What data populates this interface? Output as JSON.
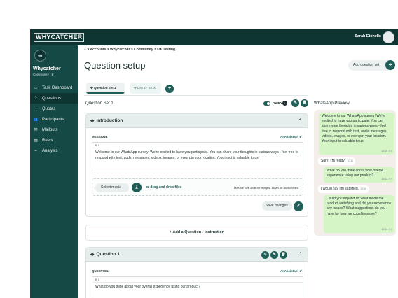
{
  "topbar": {
    "logo": "WHYCATCHER",
    "user_name": "Sarah Etchells"
  },
  "sidebar": {
    "avatar_initials": "WY",
    "org_name": "Whycatcher",
    "org_type": "Community",
    "org_type_icon": "♛",
    "items": [
      {
        "label": "Task Dashboard",
        "icon": "home-icon",
        "glyph": "⌂",
        "active": false
      },
      {
        "label": "Questions",
        "icon": "question-icon",
        "glyph": "?",
        "active": true
      },
      {
        "label": "Quotas",
        "icon": "quota-icon",
        "glyph": "◔",
        "active": false
      },
      {
        "label": "Participants",
        "icon": "participants-icon",
        "glyph": "👥",
        "active": false
      },
      {
        "label": "Mailouts",
        "icon": "mail-icon",
        "glyph": "✉",
        "active": false
      },
      {
        "label": "Reels",
        "icon": "film-icon",
        "glyph": "▤",
        "active": false
      },
      {
        "label": "Analysis",
        "icon": "chart-icon",
        "glyph": "⌁",
        "active": false
      }
    ]
  },
  "breadcrumb": {
    "home_glyph": "⌂",
    "sep": ">",
    "items": [
      "Accounts",
      "Whycatcher",
      "Community",
      "UX Testing"
    ]
  },
  "page": {
    "title": "Question setup",
    "add_set_label": "Add question set",
    "plus": "+"
  },
  "tabs": [
    {
      "label": "Question Set 1",
      "icon": "✥"
    },
    {
      "label": "Day 2 - 09:00",
      "icon": "✥"
    }
  ],
  "question_set": {
    "label": "Question Set 1",
    "diary_label": "DAIRY",
    "info_glyph": "i",
    "edit_glyph": "✎",
    "delete_glyph": "🗑"
  },
  "intro": {
    "title": "Introduction",
    "drag_glyph": "✥",
    "chevron": "⌃",
    "message_label": "MESSAGE",
    "ai_label": "AI Assistant ✐",
    "toolbar": "B  I",
    "message_text": "Welcome to our WhatsApp survey! We're excited to have you participate. You can share your thoughts in various ways - feel free to respond with text, audio messages, videos, images, or even pin your location. Your input is valuable to us!",
    "select_media_label": "Select media",
    "upload_glyph": "⤓",
    "drag_drop_label": "or drag and drop files",
    "file_note": "Max file size 5MB for images, 16MB for Audio/Video",
    "save_label": "Save changes",
    "check_glyph": "✓"
  },
  "add_question_label": "+ Add a Question / Instruction",
  "question1": {
    "title": "Question 1",
    "question_label": "QUESTION",
    "ai_label": "AI Assistant ✐",
    "toolbar": "B  I",
    "text": "What do you think about your overall experience using our product?",
    "icon1": "⊙",
    "icon2": "✎",
    "icon3": "🗑"
  },
  "preview": {
    "title": "WhatsApp Preview",
    "messages": [
      {
        "dir": "out",
        "text": "Welcome to our WhatsApp survey! We're excited to have you participate. You can share your thoughts in various ways - feel free to respond with text, audio messages, videos, images, or even pin your location. Your input is valuable to us!",
        "time": "10:15 ✓✓"
      },
      {
        "dir": "in",
        "text": "Sure, I'm ready!",
        "time": "10:11"
      },
      {
        "dir": "out",
        "text": "What do you think about your overall experience using our product?",
        "time": "10:12 ✓✓"
      },
      {
        "dir": "in",
        "text": "I would say I'm satisfied.",
        "time": "10:13"
      },
      {
        "dir": "out",
        "text": "Could you expand on what made the product satisfying and did you experience any issues? What suggestions do you have for how we could improve?",
        "time": "10:14 ✓✓"
      }
    ]
  }
}
